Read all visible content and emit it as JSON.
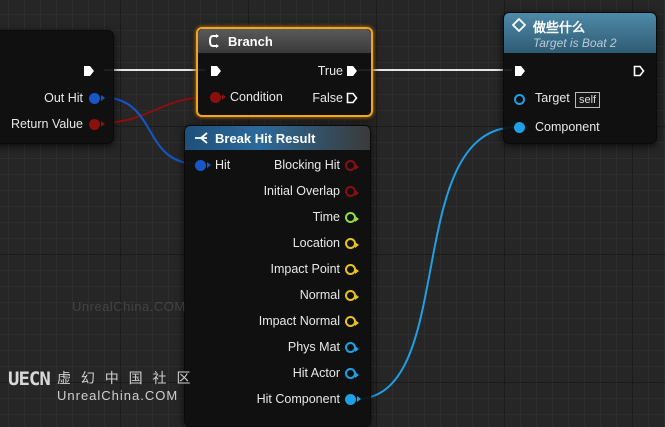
{
  "colors": {
    "exec": "#ffffff",
    "bool": "#8c0f0f",
    "struct": "#1756c9",
    "object": "#1ea0e6",
    "vector": "#e6c21e",
    "float": "#8de03c",
    "branch_outline": "#f0a524"
  },
  "left_node": {
    "pins": [
      "Out Hit",
      "Return Value"
    ]
  },
  "branch": {
    "title": "Branch",
    "icon": "branch-icon",
    "inputs": [
      "Condition"
    ],
    "outputs": [
      "True",
      "False"
    ]
  },
  "break_hit": {
    "title": "Break Hit Result",
    "icon": "break-struct-icon",
    "input": "Hit",
    "outputs": [
      "Blocking Hit",
      "Initial Overlap",
      "Time",
      "Location",
      "Impact Point",
      "Normal",
      "Impact Normal",
      "Phys Mat",
      "Hit Actor",
      "Hit Component"
    ]
  },
  "event_node": {
    "title": "做些什么",
    "subtitle": "Target is Boat 2",
    "icon": "function-icon",
    "target_label": "Target",
    "target_value": "self",
    "component_label": "Component"
  },
  "watermark": {
    "center": "UnrealChina.COM",
    "logo_text": "UECN",
    "logo_cn": "虚 幻 中 国 社 区",
    "logo_url": "UnrealChina.COM"
  }
}
